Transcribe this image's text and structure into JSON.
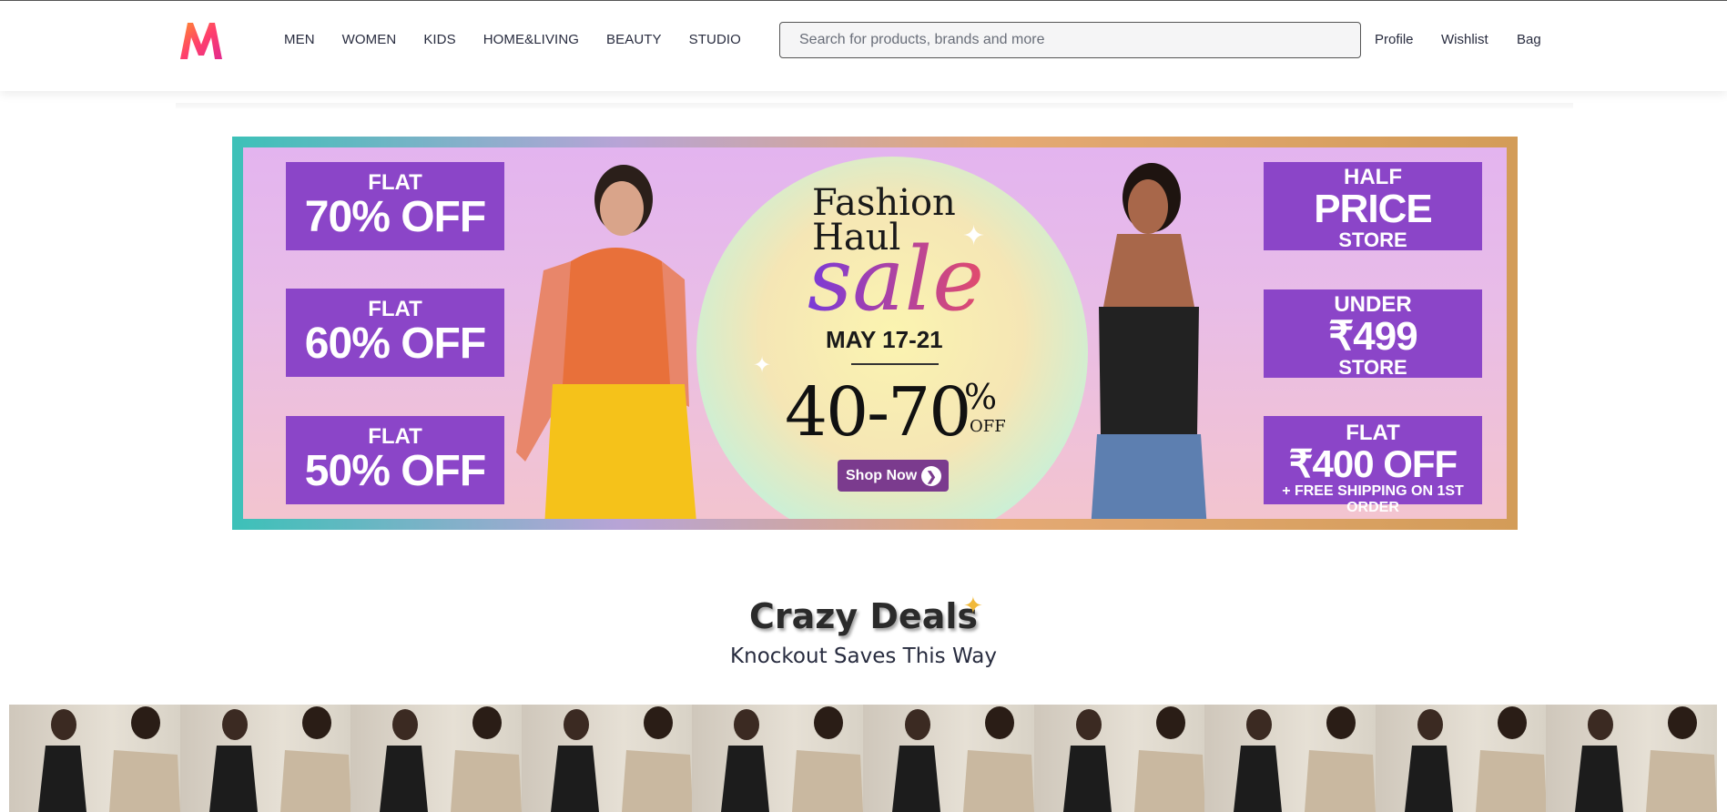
{
  "header": {
    "logo_alt": "Myntra",
    "nav": [
      "MEN",
      "WOMEN",
      "KIDS",
      "HOME&LIVING",
      "BEAUTY",
      "STUDIO"
    ],
    "search_placeholder": "Search for products, brands and more",
    "actions": [
      "Profile",
      "Wishlist",
      "Bag"
    ]
  },
  "banner": {
    "left_promos": [
      {
        "l1": "FLAT",
        "l2": "70% OFF"
      },
      {
        "l1": "FLAT",
        "l2": "60% OFF"
      },
      {
        "l1": "FLAT",
        "l2": "50% OFF"
      }
    ],
    "right_promos": [
      {
        "l1": "HALF",
        "l2": "PRICE",
        "l3": "STORE"
      },
      {
        "l1": "UNDER",
        "l2": "₹499",
        "l3": "STORE"
      },
      {
        "l1": "FLAT",
        "l2": "₹400 OFF",
        "l3": "+ FREE SHIPPING ON 1ST ORDER"
      }
    ],
    "title_line1": "Fashion",
    "title_line2": "Haul",
    "sale": "sale",
    "dates": "MAY 17-21",
    "discount": "40-70",
    "pct": "%",
    "off": "OFF",
    "cta": "Shop Now"
  },
  "deals": {
    "title": "Crazy Deals",
    "subtitle": "Knockout Saves This Way"
  },
  "colors": {
    "brand_pink": "#ff3f6c",
    "promo_purple": "#8b45c8"
  }
}
